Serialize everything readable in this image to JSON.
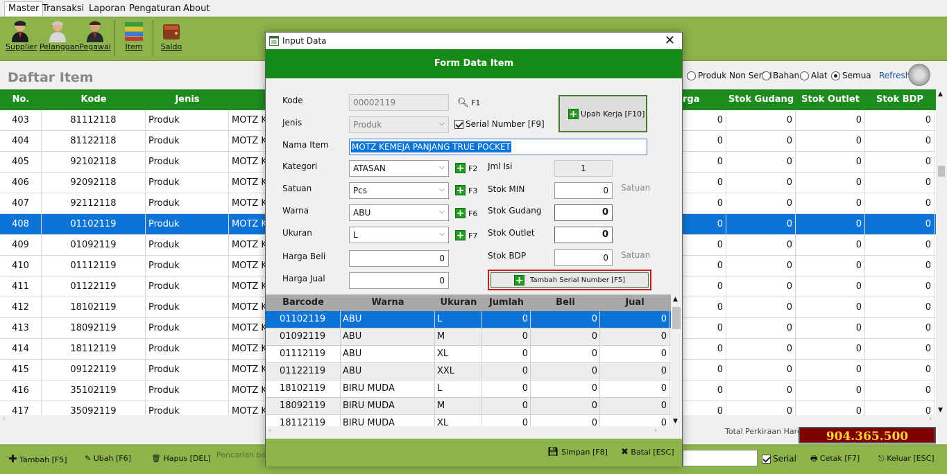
{
  "menubar": [
    "Master",
    "Transaksi",
    "Laporan",
    "Pengaturan",
    "About"
  ],
  "toolbar": {
    "supplier": "Supplier",
    "pelanggan": "Pelanggan",
    "pegawai": "Pegawai",
    "item": "Item",
    "saldo": "Saldo"
  },
  "page": {
    "title": "Daftar Item",
    "filters": {
      "produk_non_serial": "Produk Non Serial",
      "bahan": "Bahan",
      "alat": "Alat",
      "semua": "Semua",
      "selected": "Semua"
    },
    "refresh": "Refresh"
  },
  "grid": {
    "columns": [
      "No.",
      "Kode",
      "Jenis",
      "",
      "rga",
      "Stok Gudang",
      "Stok Outlet",
      "Stok BDP"
    ],
    "rows": [
      {
        "no": "403",
        "kode": "81112118",
        "jenis": "Produk",
        "nama": "MOTZ K",
        "harga": "0",
        "gudang": "0",
        "outlet": "0",
        "bdp": "0"
      },
      {
        "no": "404",
        "kode": "81122118",
        "jenis": "Produk",
        "nama": "MOTZ K",
        "harga": "0",
        "gudang": "0",
        "outlet": "0",
        "bdp": "0"
      },
      {
        "no": "405",
        "kode": "92102118",
        "jenis": "Produk",
        "nama": "MOTZ K",
        "harga": "0",
        "gudang": "0",
        "outlet": "0",
        "bdp": "0"
      },
      {
        "no": "406",
        "kode": "92092118",
        "jenis": "Produk",
        "nama": "MOTZ K",
        "harga": "0",
        "gudang": "0",
        "outlet": "0",
        "bdp": "0"
      },
      {
        "no": "407",
        "kode": "92112118",
        "jenis": "Produk",
        "nama": "MOTZ K",
        "harga": "0",
        "gudang": "0",
        "outlet": "0",
        "bdp": "0"
      },
      {
        "no": "408",
        "kode": "01102119",
        "jenis": "Produk",
        "nama": "MOTZ K",
        "harga": "0",
        "gudang": "0",
        "outlet": "0",
        "bdp": "0"
      },
      {
        "no": "409",
        "kode": "01092119",
        "jenis": "Produk",
        "nama": "MOTZ K",
        "harga": "0",
        "gudang": "0",
        "outlet": "0",
        "bdp": "0"
      },
      {
        "no": "410",
        "kode": "01112119",
        "jenis": "Produk",
        "nama": "MOTZ K",
        "harga": "0",
        "gudang": "0",
        "outlet": "0",
        "bdp": "0"
      },
      {
        "no": "411",
        "kode": "01122119",
        "jenis": "Produk",
        "nama": "MOTZ K",
        "harga": "0",
        "gudang": "0",
        "outlet": "0",
        "bdp": "0"
      },
      {
        "no": "412",
        "kode": "18102119",
        "jenis": "Produk",
        "nama": "MOTZ K",
        "harga": "0",
        "gudang": "0",
        "outlet": "0",
        "bdp": "0"
      },
      {
        "no": "413",
        "kode": "18092119",
        "jenis": "Produk",
        "nama": "MOTZ K",
        "harga": "0",
        "gudang": "0",
        "outlet": "0",
        "bdp": "0"
      },
      {
        "no": "414",
        "kode": "18112119",
        "jenis": "Produk",
        "nama": "MOTZ K",
        "harga": "0",
        "gudang": "0",
        "outlet": "0",
        "bdp": "0"
      },
      {
        "no": "415",
        "kode": "09122119",
        "jenis": "Produk",
        "nama": "MOTZ K",
        "harga": "0",
        "gudang": "0",
        "outlet": "0",
        "bdp": "0"
      },
      {
        "no": "416",
        "kode": "35102119",
        "jenis": "Produk",
        "nama": "MOTZ K",
        "harga": "0",
        "gudang": "0",
        "outlet": "0",
        "bdp": "0"
      },
      {
        "no": "417",
        "kode": "35092119",
        "jenis": "Produk",
        "nama": "MOTZ K",
        "harga": "0",
        "gudang": "0",
        "outlet": "0",
        "bdp": "0"
      }
    ],
    "selected_no": "408"
  },
  "total": {
    "label": "Total Perkiraan Harga",
    "value": "904.365.500"
  },
  "bottombar": {
    "tambah": "Tambah [F5]",
    "ubah": "Ubah [F6]",
    "hapus": "Hapus [DEL]",
    "search_hint": "Pencarian berd",
    "serial": "Serial",
    "cetak": "Cetak [F7]",
    "keluar": "Keluar [ESC]"
  },
  "dialog": {
    "title": "Input Data",
    "header": "Form Data Item",
    "labels": {
      "kode": "Kode",
      "jenis": "Jenis",
      "nama_item": "Nama Item",
      "kategori": "Kategori",
      "satuan": "Satuan",
      "warna": "Warna",
      "ukuran": "Ukuran",
      "harga_beli": "Harga Beli",
      "harga_jual": "Harga Jual",
      "jml_isi": "Jml Isi",
      "stok_min": "Stok MIN",
      "stok_gudang": "Stok Gudang",
      "stok_outlet": "Stok Outlet",
      "stok_bdp": "Stok BDP",
      "satuan_unit1": "Satuan",
      "satuan_unit2": "Satuan"
    },
    "values": {
      "kode": "00002119",
      "jenis": "Produk",
      "nama_item": "MOTZ KEMEJA PANJANG TRUE POCKET",
      "kategori": "ATASAN",
      "satuan": "Pcs",
      "warna": "ABU",
      "ukuran": "L",
      "harga_beli": "0",
      "harga_jual": "0",
      "jml_isi": "1",
      "stok_min": "0",
      "stok_gudang": "0",
      "stok_outlet": "0",
      "stok_bdp": "0"
    },
    "keys": {
      "f1": "F1",
      "f2": "F2",
      "f3": "F3",
      "f6": "F6",
      "f7": "F7"
    },
    "serial_number": "Serial Number [F9]",
    "upah_kerja": "Upah Kerja [F10]",
    "tambah_serial": "Tambah Serial Number [F5]",
    "sub_columns": [
      "Barcode",
      "Warna",
      "Ukuran",
      "Jumlah",
      "Beli",
      "Jual"
    ],
    "sub_rows": [
      {
        "barcode": "01102119",
        "warna": "ABU",
        "ukuran": "L",
        "jumlah": "0",
        "beli": "0",
        "jual": "0"
      },
      {
        "barcode": "01092119",
        "warna": "ABU",
        "ukuran": "M",
        "jumlah": "0",
        "beli": "0",
        "jual": "0"
      },
      {
        "barcode": "01112119",
        "warna": "ABU",
        "ukuran": "XL",
        "jumlah": "0",
        "beli": "0",
        "jual": "0"
      },
      {
        "barcode": "01122119",
        "warna": "ABU",
        "ukuran": "XXL",
        "jumlah": "0",
        "beli": "0",
        "jual": "0"
      },
      {
        "barcode": "18102119",
        "warna": "BIRU MUDA",
        "ukuran": "L",
        "jumlah": "0",
        "beli": "0",
        "jual": "0"
      },
      {
        "barcode": "18092119",
        "warna": "BIRU MUDA",
        "ukuran": "M",
        "jumlah": "0",
        "beli": "0",
        "jual": "0"
      },
      {
        "barcode": "18112119",
        "warna": "BIRU MUDA",
        "ukuran": "XL",
        "jumlah": "0",
        "beli": "0",
        "jual": "0"
      }
    ],
    "simpan": "Simpan [F8]",
    "batal": "Batal [ESC]"
  }
}
